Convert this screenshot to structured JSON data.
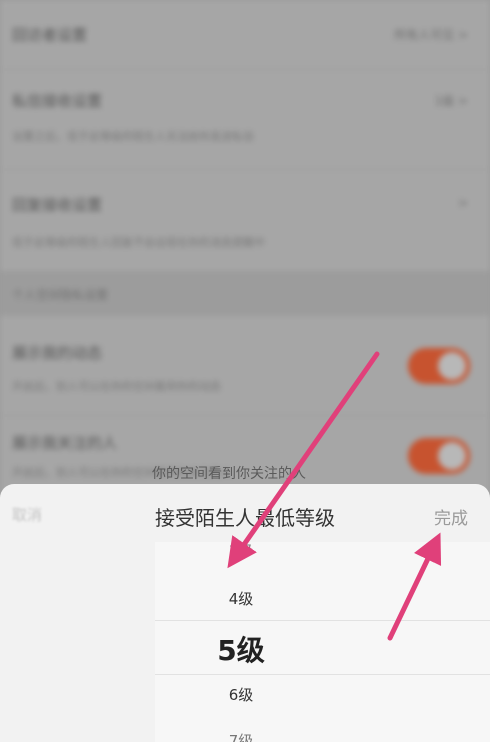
{
  "background": {
    "row1": {
      "title": "回访者设置",
      "value": "所有人可见 >"
    },
    "row2": {
      "title": "私信接收设置",
      "value": "1级 >",
      "subtitle": "设置之后，低于此等级的陌生人无法给你发送私信"
    },
    "row3": {
      "title": "回复接收设置",
      "value": ">",
      "subtitle": "低于此等级的陌生人回复不会出现在你的消息提醒中"
    },
    "section": "个人空间隐私设置",
    "row4": {
      "title": "展示我的动态",
      "subtitle": "开启后，别人可以在你的空间看到你的动态"
    },
    "row5": {
      "title": "展示我关注的人",
      "subtitle": "开启后，别人可以在你的空间看到你关注的人",
      "subtitle_visible": "你的空间看到你关注的人"
    }
  },
  "sheet": {
    "cancel_label": "取消",
    "title": "接受陌生人最低等级",
    "done_label": "完成"
  },
  "picker": {
    "options": [
      "3级",
      "4级",
      "5级",
      "6级",
      "7级"
    ],
    "selected": "5级"
  },
  "colors": {
    "toggle_on": "#c7532f",
    "arrow": "#e0407a"
  }
}
